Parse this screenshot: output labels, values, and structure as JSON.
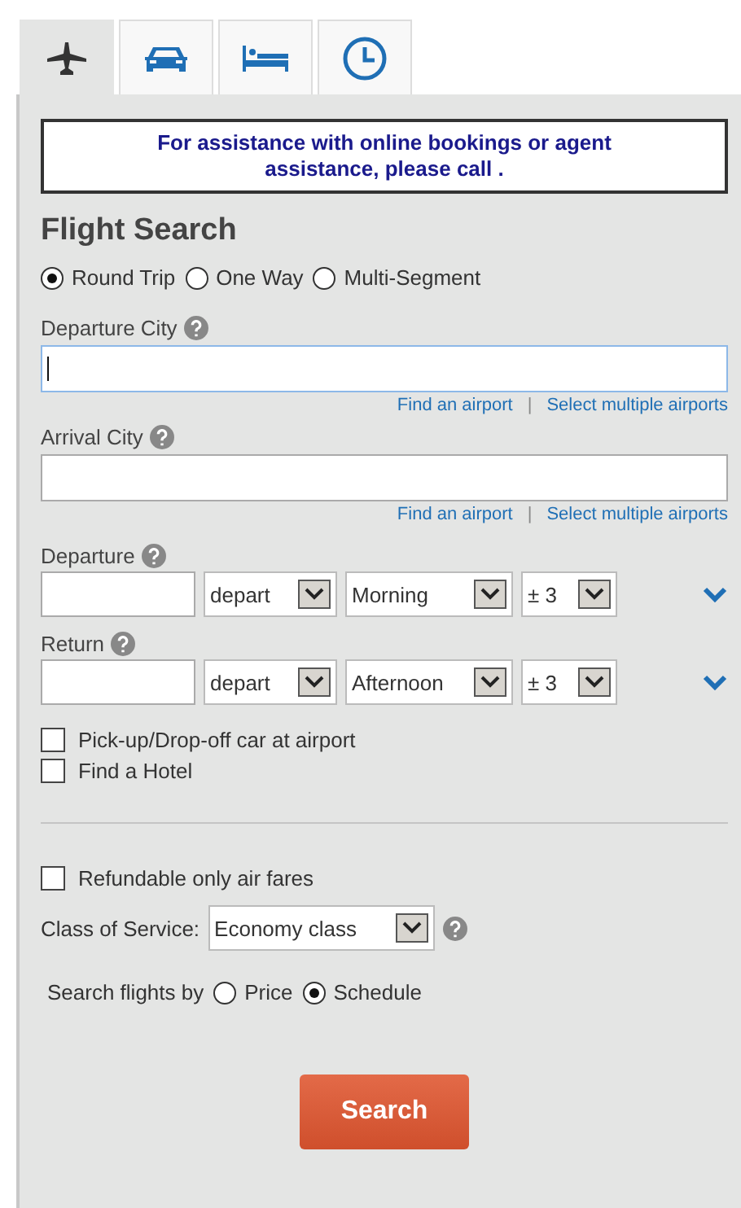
{
  "tabs": [
    {
      "kind": "plane",
      "selected": true
    },
    {
      "kind": "car",
      "selected": false
    },
    {
      "kind": "bed",
      "selected": false
    },
    {
      "kind": "clock",
      "selected": false
    }
  ],
  "notice": "For assistance with online bookings or agent assistance, please call .",
  "title": "Flight Search",
  "trip_types": [
    {
      "label": "Round Trip",
      "selected": true
    },
    {
      "label": "One Way",
      "selected": false
    },
    {
      "label": "Multi-Segment",
      "selected": false
    }
  ],
  "cities": [
    {
      "label": "Departure City",
      "focused": true,
      "links": [
        "Find an airport",
        "|",
        "Select multiple airports"
      ]
    },
    {
      "label": "Arrival City",
      "focused": false,
      "links": [
        "Find an airport",
        "|",
        "Select multiple airports"
      ]
    }
  ],
  "dates": [
    {
      "label": "Departure",
      "mode": "depart",
      "time": "Morning",
      "range": "± 3"
    },
    {
      "label": "Return",
      "mode": "depart",
      "time": "Afternoon",
      "range": "± 3"
    }
  ],
  "extras": [
    {
      "label": "Pick-up/Drop-off car at airport",
      "checked": false
    },
    {
      "label": "Find a Hotel",
      "checked": false
    }
  ],
  "refundable": {
    "label": "Refundable only air fares",
    "checked": false
  },
  "class_of_service": {
    "label": "Class of Service:",
    "value": "Economy class"
  },
  "search_by": {
    "label": "Search flights by",
    "options": [
      {
        "label": "Price",
        "selected": false
      },
      {
        "label": "Schedule",
        "selected": true
      }
    ]
  },
  "search_button": "Search"
}
